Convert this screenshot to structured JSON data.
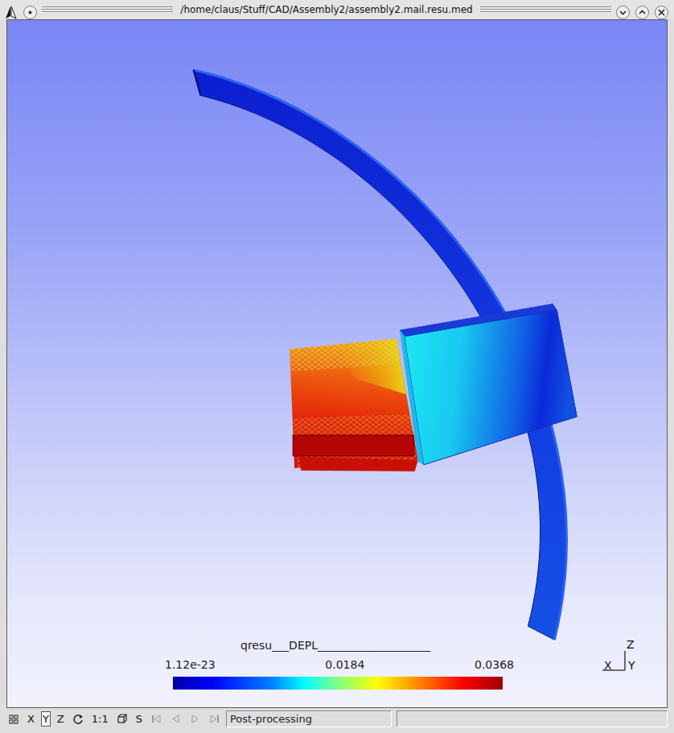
{
  "window": {
    "title": "/home/claus/Stuff/CAD/Assembly2/assembly2.mail.resu.med"
  },
  "legend": {
    "title": "qresu___DEPL____________________",
    "ticks": [
      "1.12e-23",
      "0.0184",
      "0.0368"
    ]
  },
  "axes": {
    "up": "Z",
    "left": "X",
    "right": "Y"
  },
  "toolbar": [
    {
      "kind": "grid",
      "disabled": false
    },
    {
      "kind": "text",
      "label": "X",
      "selected": false
    },
    {
      "kind": "text",
      "label": "Y",
      "selected": true
    },
    {
      "kind": "text",
      "label": "Z",
      "selected": false
    },
    {
      "kind": "rotate",
      "disabled": false
    },
    {
      "kind": "text",
      "label": "1:1",
      "selected": false
    },
    {
      "kind": "cube",
      "disabled": false
    },
    {
      "kind": "text",
      "label": "S",
      "selected": false
    },
    {
      "kind": "first",
      "disabled": true
    },
    {
      "kind": "prev",
      "disabled": true
    },
    {
      "kind": "next",
      "disabled": true
    },
    {
      "kind": "last",
      "disabled": true
    }
  ],
  "status_bar": {
    "mode": "Post-processing"
  }
}
